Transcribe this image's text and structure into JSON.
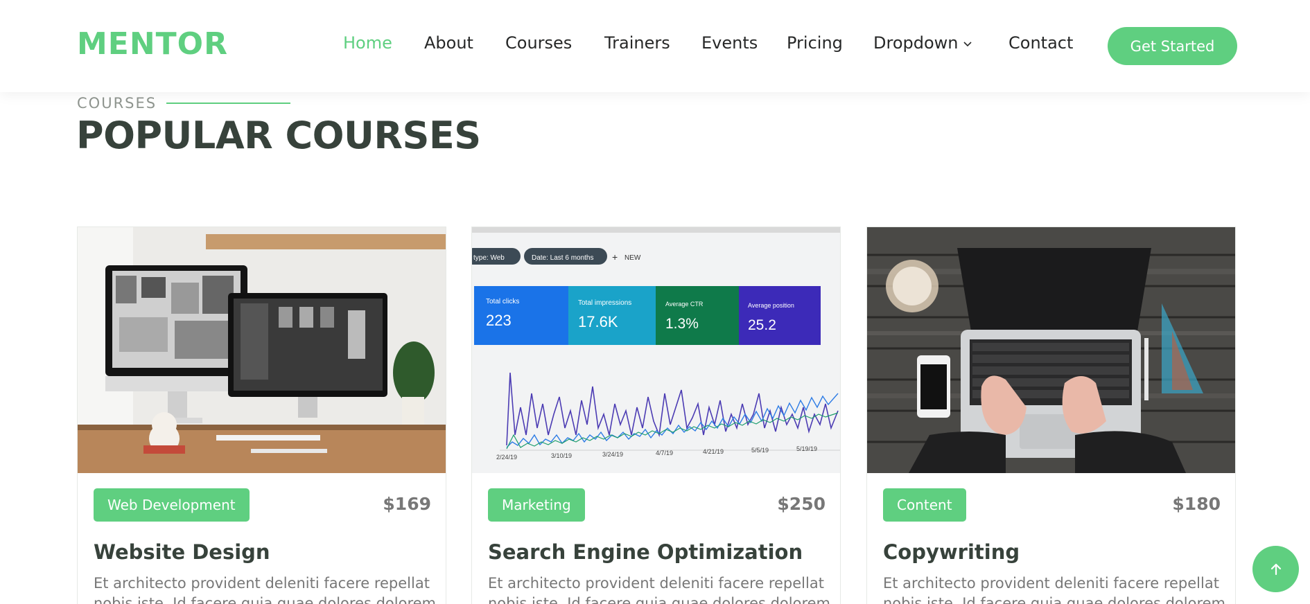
{
  "header": {
    "logo": "MENTOR",
    "nav": [
      {
        "label": "Home",
        "active": true
      },
      {
        "label": "About"
      },
      {
        "label": "Courses"
      },
      {
        "label": "Trainers"
      },
      {
        "label": "Events"
      },
      {
        "label": "Pricing"
      },
      {
        "label": "Dropdown",
        "has_dropdown": true
      },
      {
        "label": "Contact"
      }
    ],
    "cta_label": "Get Started"
  },
  "section": {
    "eyebrow": "COURSES",
    "title": "POPULAR COURSES"
  },
  "courses": [
    {
      "category": "Web Development",
      "price": "$169",
      "title": "Website Design",
      "description": "Et architecto provident deleniti facere repellat nobis iste. Id facere quia quae dolores dolorem"
    },
    {
      "category": "Marketing",
      "price": "$250",
      "title": "Search Engine Optimization",
      "description": "Et architecto provident deleniti facere repellat nobis iste. Id facere quia quae dolores dolorem",
      "image_text": {
        "filter_type": "type: Web",
        "filter_date": "Date: Last 6 months",
        "new_label": "NEW",
        "metrics": [
          {
            "label": "Total clicks",
            "value": "223"
          },
          {
            "label": "Total impressions",
            "value": "17.6K"
          },
          {
            "label": "Average CTR",
            "value": "1.3%"
          },
          {
            "label": "Average position",
            "value": "25.2"
          }
        ],
        "dates": [
          "2/24/19",
          "3/10/19",
          "3/24/19",
          "4/7/19",
          "4/21/19",
          "5/5/19",
          "5/19/19"
        ]
      }
    },
    {
      "category": "Content",
      "price": "$180",
      "title": "Copywriting",
      "description": "Et architecto provident deleniti facere repellat nobis iste. Id facere quia quae dolores dolorem"
    }
  ],
  "colors": {
    "accent": "#5fcf80",
    "heading": "#37423b",
    "text": "#777777"
  },
  "icons": {
    "dropdown": "chevron-down-icon",
    "scroll_top": "arrow-up-icon"
  }
}
